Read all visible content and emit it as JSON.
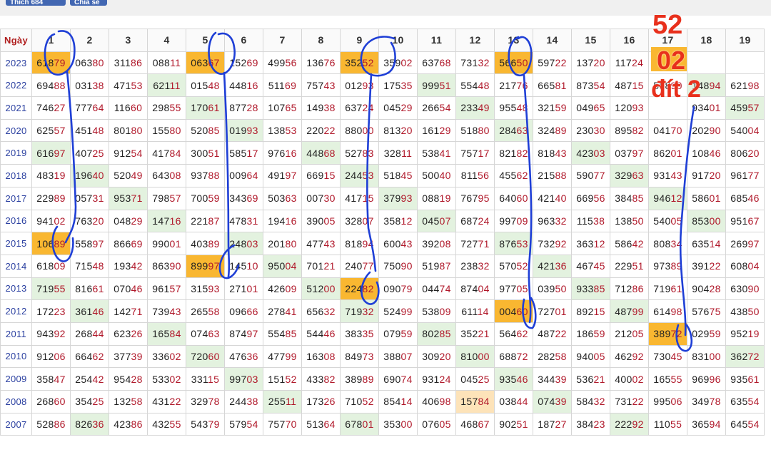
{
  "top_buttons": [
    "Thích 684",
    "Chia sẻ"
  ],
  "header": {
    "corner": "Ngày",
    "days": [
      "1",
      "2",
      "3",
      "4",
      "5",
      "6",
      "7",
      "8",
      "9",
      "10",
      "11",
      "12",
      "13",
      "14",
      "15",
      "16",
      "17",
      "18",
      "19"
    ]
  },
  "rows": [
    {
      "year": "2023",
      "cells": [
        "61879",
        "06380",
        "31186",
        "08811",
        "06367",
        "15269",
        "49956",
        "13676",
        "35252",
        "35902",
        "63768",
        "73132",
        "56650",
        "59722",
        "13720",
        "11724",
        "",
        "",
        ""
      ],
      "hl": [
        "o",
        "",
        "",
        "",
        "o",
        "",
        "",
        "",
        "o",
        "",
        "",
        "",
        "o",
        "",
        "",
        "",
        "",
        "",
        ""
      ]
    },
    {
      "year": "2022",
      "cells": [
        "69488",
        "03138",
        "47153",
        "62111",
        "01548",
        "44816",
        "51169",
        "75743",
        "01293",
        "17535",
        "99951",
        "55448",
        "21776",
        "66581",
        "87354",
        "48715",
        "55890",
        "14894",
        "62198"
      ],
      "hl": [
        "",
        "",
        "",
        "g",
        "",
        "",
        "",
        "",
        "",
        "",
        "g",
        "",
        "",
        "",
        "",
        "",
        "",
        "g",
        ""
      ]
    },
    {
      "year": "2021",
      "cells": [
        "74627",
        "77764",
        "11660",
        "29855",
        "17061",
        "87728",
        "10765",
        "14938",
        "63724",
        "04529",
        "26654",
        "23349",
        "95548",
        "32159",
        "04965",
        "12093",
        "",
        "93401",
        "45957"
      ],
      "hl": [
        "",
        "",
        "",
        "",
        "g",
        "",
        "",
        "",
        "",
        "",
        "",
        "g",
        "",
        "",
        "",
        "",
        "",
        "",
        "g"
      ]
    },
    {
      "year": "2020",
      "cells": [
        "62557",
        "45148",
        "80180",
        "15580",
        "52085",
        "01993",
        "13853",
        "22022",
        "88000",
        "81320",
        "16129",
        "51880",
        "28463",
        "32489",
        "23030",
        "89582",
        "04170",
        "20290",
        "54004"
      ],
      "hl": [
        "",
        "",
        "",
        "",
        "",
        "g",
        "",
        "",
        "",
        "",
        "",
        "",
        "g",
        "",
        "",
        "",
        "",
        "",
        ""
      ]
    },
    {
      "year": "2019",
      "cells": [
        "61697",
        "40725",
        "91254",
        "41784",
        "30051",
        "58517",
        "97616",
        "44868",
        "52783",
        "32811",
        "53841",
        "75717",
        "82182",
        "81843",
        "42303",
        "03797",
        "86201",
        "10846",
        "80620"
      ],
      "hl": [
        "g",
        "",
        "",
        "",
        "",
        "",
        "",
        "g",
        "",
        "",
        "",
        "",
        "",
        "",
        "g",
        "",
        "",
        "",
        ""
      ]
    },
    {
      "year": "2018",
      "cells": [
        "48319",
        "19640",
        "52049",
        "64308",
        "93788",
        "00964",
        "49197",
        "66915",
        "24453",
        "51845",
        "50040",
        "81156",
        "45562",
        "21588",
        "59077",
        "32963",
        "93143",
        "91720",
        "96177"
      ],
      "hl": [
        "",
        "g",
        "",
        "",
        "",
        "",
        "",
        "",
        "g",
        "",
        "",
        "",
        "",
        "",
        "",
        "g",
        "",
        "",
        ""
      ]
    },
    {
      "year": "2017",
      "cells": [
        "22989",
        "05731",
        "95371",
        "79857",
        "70059",
        "34369",
        "50363",
        "00730",
        "41715",
        "37993",
        "08819",
        "76795",
        "64060",
        "42140",
        "66956",
        "38485",
        "94612",
        "58601",
        "68546"
      ],
      "hl": [
        "",
        "",
        "g",
        "",
        "",
        "",
        "",
        "",
        "",
        "g",
        "",
        "",
        "",
        "",
        "",
        "",
        "g",
        "",
        ""
      ]
    },
    {
      "year": "2016",
      "cells": [
        "94102",
        "76320",
        "04829",
        "14716",
        "22187",
        "47831",
        "19416",
        "39005",
        "32807",
        "35812",
        "04507",
        "68724",
        "99709",
        "96332",
        "11538",
        "13850",
        "54005",
        "85300",
        "95167"
      ],
      "hl": [
        "",
        "",
        "",
        "g",
        "",
        "",
        "",
        "",
        "",
        "",
        "g",
        "",
        "",
        "",
        "",
        "",
        "",
        "g",
        ""
      ]
    },
    {
      "year": "2015",
      "cells": [
        "10689",
        "55897",
        "86669",
        "99001",
        "40389",
        "24803",
        "20180",
        "47743",
        "81894",
        "60043",
        "39208",
        "72771",
        "87653",
        "73292",
        "36312",
        "58642",
        "80834",
        "63514",
        "26997"
      ],
      "hl": [
        "o",
        "",
        "",
        "",
        "",
        "g",
        "",
        "",
        "",
        "",
        "",
        "",
        "g",
        "",
        "",
        "",
        "",
        "",
        ""
      ]
    },
    {
      "year": "2014",
      "cells": [
        "61809",
        "71548",
        "19342",
        "86390",
        "89997",
        "14510",
        "95004",
        "70121",
        "24077",
        "75090",
        "51987",
        "23832",
        "57052",
        "42136",
        "46745",
        "22951",
        "97389",
        "39122",
        "60804"
      ],
      "hl": [
        "",
        "",
        "",
        "",
        "o",
        "",
        "g",
        "",
        "",
        "",
        "",
        "",
        "",
        "g",
        "",
        "",
        "",
        "",
        ""
      ]
    },
    {
      "year": "2013",
      "cells": [
        "71955",
        "81661",
        "07046",
        "96157",
        "31593",
        "27101",
        "42609",
        "51200",
        "22482",
        "09079",
        "04474",
        "87404",
        "97705",
        "03950",
        "93385",
        "71286",
        "71961",
        "90428",
        "63090"
      ],
      "hl": [
        "g",
        "",
        "",
        "",
        "",
        "",
        "",
        "g",
        "o",
        "",
        "",
        "",
        "",
        "",
        "g",
        "",
        "",
        "",
        ""
      ]
    },
    {
      "year": "2012",
      "cells": [
        "17223",
        "36146",
        "14271",
        "73943",
        "26558",
        "09666",
        "27841",
        "65632",
        "71932",
        "52499",
        "53809",
        "61114",
        "00460",
        "72701",
        "89215",
        "48799",
        "61498",
        "57675",
        "43850"
      ],
      "hl": [
        "",
        "g",
        "",
        "",
        "",
        "",
        "",
        "",
        "g",
        "",
        "",
        "",
        "o",
        "",
        "",
        "g",
        "",
        "",
        ""
      ]
    },
    {
      "year": "2011",
      "cells": [
        "94392",
        "26844",
        "62326",
        "16584",
        "07463",
        "87497",
        "55485",
        "54446",
        "38335",
        "07959",
        "80285",
        "35221",
        "56462",
        "48722",
        "18659",
        "21205",
        "38972",
        "02959",
        "95219"
      ],
      "hl": [
        "",
        "",
        "",
        "g",
        "",
        "",
        "",
        "",
        "",
        "",
        "g",
        "",
        "",
        "",
        "",
        "",
        "o",
        "",
        ""
      ]
    },
    {
      "year": "2010",
      "cells": [
        "91206",
        "66462",
        "37739",
        "33602",
        "72060",
        "47636",
        "47799",
        "16308",
        "84973",
        "38807",
        "30920",
        "81000",
        "68872",
        "28258",
        "94005",
        "46292",
        "73045",
        "83100",
        "36272"
      ],
      "hl": [
        "",
        "",
        "",
        "",
        "g",
        "",
        "",
        "",
        "",
        "",
        "",
        "g",
        "",
        "",
        "",
        "",
        "",
        "",
        "g"
      ]
    },
    {
      "year": "2009",
      "cells": [
        "35847",
        "25442",
        "95428",
        "53302",
        "33115",
        "99703",
        "15152",
        "43382",
        "38989",
        "69074",
        "93124",
        "04525",
        "93546",
        "34439",
        "53621",
        "40002",
        "16555",
        "96996",
        "93561"
      ],
      "hl": [
        "",
        "",
        "",
        "",
        "",
        "g",
        "",
        "",
        "",
        "",
        "",
        "",
        "g",
        "",
        "",
        "",
        "",
        "",
        ""
      ]
    },
    {
      "year": "2008",
      "cells": [
        "26860",
        "35425",
        "13258",
        "43122",
        "32978",
        "24438",
        "25511",
        "17326",
        "71052",
        "85414",
        "40698",
        "15784",
        "03844",
        "07439",
        "58432",
        "73122",
        "99506",
        "34978",
        "63554"
      ],
      "hl": [
        "",
        "",
        "",
        "",
        "",
        "",
        "g",
        "",
        "",
        "",
        "",
        "l",
        "",
        "g",
        "",
        "",
        "",
        "",
        ""
      ]
    },
    {
      "year": "2007",
      "cells": [
        "52886",
        "82636",
        "42386",
        "43255",
        "54379",
        "57954",
        "75770",
        "51364",
        "67801",
        "35300",
        "07605",
        "46867",
        "90251",
        "18727",
        "38423",
        "22292",
        "11055",
        "36594",
        "64554"
      ],
      "hl": [
        "",
        "g",
        "",
        "",
        "",
        "",
        "",
        "",
        "g",
        "",
        "",
        "",
        "",
        "",
        "",
        "g",
        "",
        "",
        ""
      ]
    }
  ],
  "annotations": [
    "52",
    "02",
    "đít 2"
  ],
  "colors": {
    "highlight_orange": "#f9b731",
    "highlight_green": "#e3f2df",
    "tail_red": "#b0182a",
    "year_blue": "#2a3fa0",
    "pen_blue": "#1f3fd6",
    "annotation_red": "#e8301c"
  }
}
